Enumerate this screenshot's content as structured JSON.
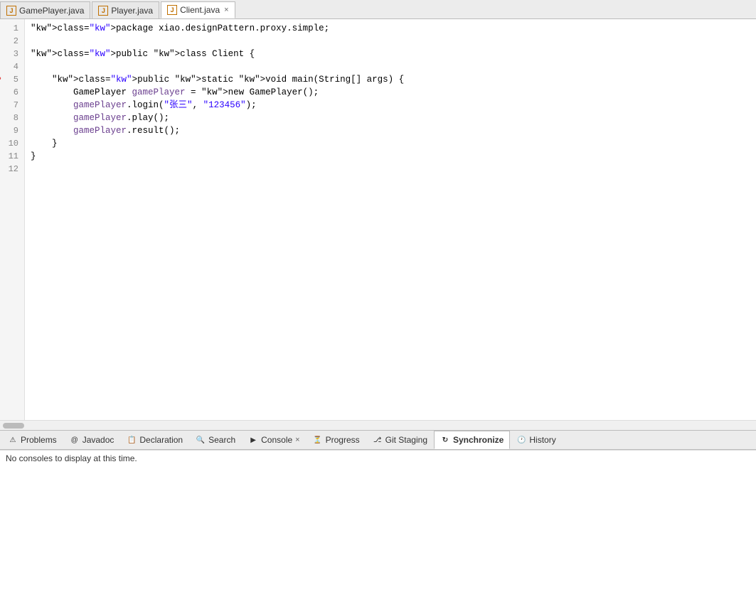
{
  "tabs": [
    {
      "id": "tab-gameplayer",
      "label": "GamePlayer.java",
      "active": false,
      "closable": false,
      "icon": "java-icon"
    },
    {
      "id": "tab-player",
      "label": "Player.java",
      "active": false,
      "closable": false,
      "icon": "java-icon"
    },
    {
      "id": "tab-client",
      "label": "Client.java",
      "active": true,
      "closable": true,
      "icon": "java-icon"
    }
  ],
  "code": {
    "lines": [
      {
        "num": 1,
        "content": "package xiao.designPattern.proxy.simple;"
      },
      {
        "num": 2,
        "content": ""
      },
      {
        "num": 3,
        "content": "public class Client {"
      },
      {
        "num": 4,
        "content": ""
      },
      {
        "num": 5,
        "content": "    public static void main(String[] args) {",
        "breakpoint": true
      },
      {
        "num": 6,
        "content": "        GamePlayer gamePlayer = new GamePlayer();"
      },
      {
        "num": 7,
        "content": "        gamePlayer.login(\"张三\", \"123456\");"
      },
      {
        "num": 8,
        "content": "        gamePlayer.play();"
      },
      {
        "num": 9,
        "content": "        gamePlayer.result();"
      },
      {
        "num": 10,
        "content": "    }"
      },
      {
        "num": 11,
        "content": "}"
      },
      {
        "num": 12,
        "content": ""
      }
    ]
  },
  "bottom_tabs": [
    {
      "id": "problems",
      "label": "Problems",
      "active": false,
      "closable": false,
      "icon": "problems-icon"
    },
    {
      "id": "javadoc",
      "label": "Javadoc",
      "active": false,
      "closable": false,
      "icon": "javadoc-icon"
    },
    {
      "id": "declaration",
      "label": "Declaration",
      "active": false,
      "closable": false,
      "icon": "declaration-icon"
    },
    {
      "id": "search",
      "label": "Search",
      "active": false,
      "closable": false,
      "icon": "search-icon"
    },
    {
      "id": "console",
      "label": "Console",
      "active": true,
      "closable": true,
      "icon": "console-icon"
    },
    {
      "id": "progress",
      "label": "Progress",
      "active": false,
      "closable": false,
      "icon": "progress-icon"
    },
    {
      "id": "git-staging",
      "label": "Git Staging",
      "active": false,
      "closable": false,
      "icon": "git-icon"
    },
    {
      "id": "synchronize",
      "label": "Synchronize",
      "active": false,
      "closable": false,
      "icon": "sync-icon"
    },
    {
      "id": "history",
      "label": "History",
      "active": false,
      "closable": false,
      "icon": "history-icon"
    }
  ],
  "console_message": "No consoles to display at this time."
}
